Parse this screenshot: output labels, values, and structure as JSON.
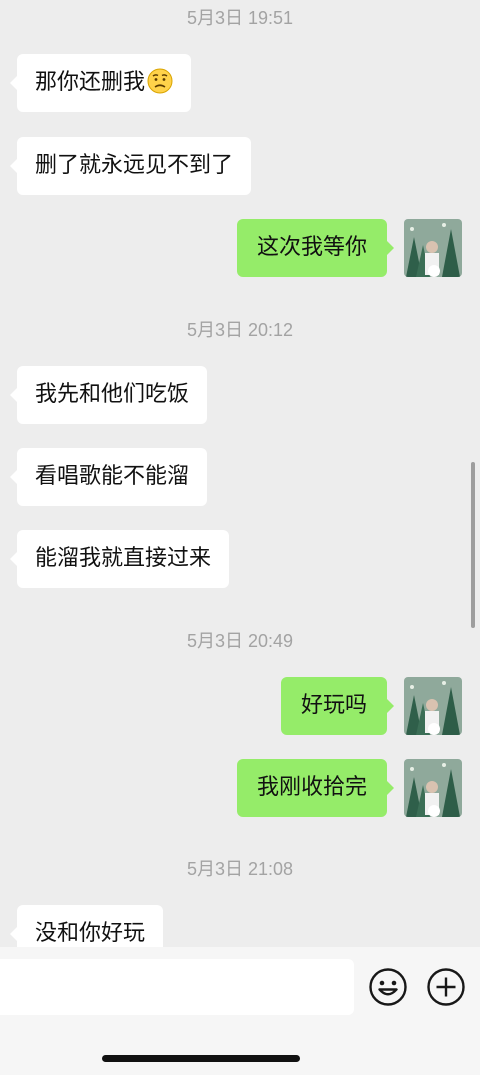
{
  "messages": [
    {
      "type": "time",
      "text": "5月3日 19:51"
    },
    {
      "type": "in",
      "text": "那你还删我",
      "emoji": "frown-emoji"
    },
    {
      "type": "in",
      "text": "删了就永远见不到了"
    },
    {
      "type": "out",
      "text": "这次我等你"
    },
    {
      "type": "time",
      "text": "5月3日 20:12"
    },
    {
      "type": "in",
      "text": "我先和他们吃饭"
    },
    {
      "type": "in",
      "text": "看唱歌能不能溜"
    },
    {
      "type": "in",
      "text": "能溜我就直接过来"
    },
    {
      "type": "time",
      "text": "5月3日 20:49"
    },
    {
      "type": "out",
      "text": "好玩吗"
    },
    {
      "type": "out",
      "text": "我刚收拾完"
    },
    {
      "type": "time",
      "text": "5月3日 21:08"
    },
    {
      "type": "in",
      "text": "没和你好玩"
    }
  ],
  "input": {
    "value": "",
    "placeholder": ""
  },
  "icons": {
    "emoji_button": "emoji-icon",
    "plus_button": "plus-icon"
  },
  "colors": {
    "background": "#ededed",
    "outgoing_bubble": "#95ec69",
    "incoming_bubble": "#ffffff",
    "timestamp": "#a3a3a3"
  }
}
